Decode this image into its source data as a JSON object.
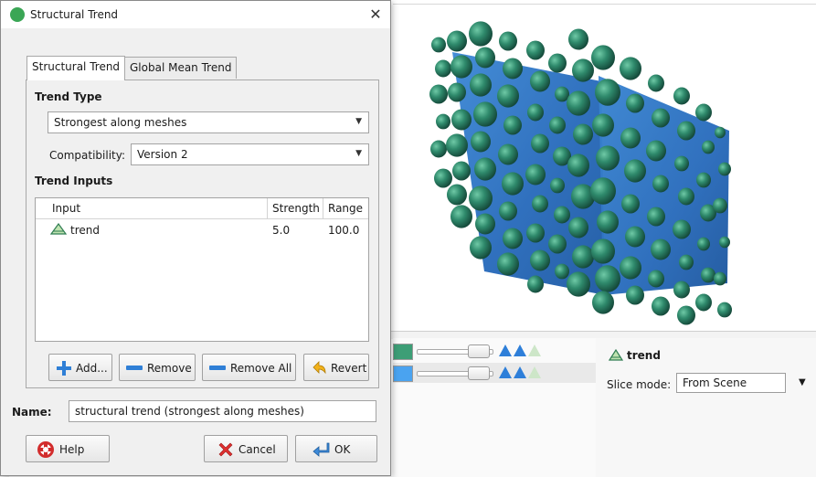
{
  "dialog": {
    "title": "Structural Trend",
    "close_glyph": "✕",
    "tabs": [
      {
        "label": "Structural Trend"
      },
      {
        "label": "Global Mean Trend"
      }
    ],
    "trend_type": {
      "heading": "Trend Type",
      "selected": "Strongest along meshes"
    },
    "compatibility": {
      "label": "Compatibility:",
      "selected": "Version 2"
    },
    "trend_inputs": {
      "heading": "Trend Inputs",
      "columns": [
        "Input",
        "Strength",
        "Range"
      ],
      "rows": [
        {
          "input": "trend",
          "strength": "5.0",
          "range": "100.0"
        }
      ]
    },
    "buttons": {
      "add": "Add...",
      "remove": "Remove",
      "remove_all": "Remove All",
      "revert": "Revert",
      "help": "Help",
      "cancel": "Cancel",
      "ok": "OK"
    },
    "name": {
      "label": "Name:",
      "value": "structural trend (strongest along meshes)"
    }
  },
  "properties": {
    "title": "trend",
    "slice_mode_label": "Slice mode:",
    "slice_mode_value": "From Scene"
  },
  "layers": [
    {
      "swatch_color": "#3d9e76"
    },
    {
      "swatch_color": "#4aa3f0"
    }
  ],
  "colors": {
    "mesh_blue": "#2f74c4",
    "sphere_green": "#2f7d65",
    "accent_blue": "#2e7fd9"
  }
}
